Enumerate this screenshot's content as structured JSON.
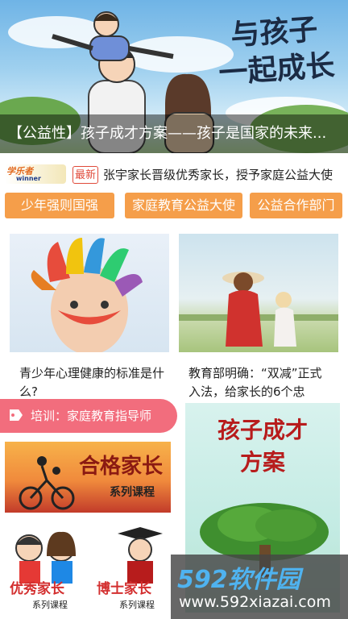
{
  "hero": {
    "title_line1": "与孩子",
    "title_line2": "一起成长",
    "caption": "【公益性】孩子成才方案——孩子是国家的未来..."
  },
  "news": {
    "logo_text": "学乐者",
    "logo_sub": "winner",
    "badge": "最新",
    "text": "张宇家长晋级优秀家长，授予家庭公益大使"
  },
  "buttons": [
    "少年强则国强",
    "家庭教育公益大使",
    "公益合作部门"
  ],
  "articles": [
    {
      "title": "青少年心理健康的标准是什么?"
    },
    {
      "title": "教育部明确：“双减”正式入法，给家长的6个忠"
    }
  ],
  "training": {
    "label": "培训：家庭教育指导师"
  },
  "courses": {
    "qualified_title": "合格家长",
    "qualified_sub": "系列课程",
    "excellent_title": "优秀家长",
    "excellent_sub": "系列课程",
    "doctor_title": "博士家长",
    "doctor_sub": "系列课程"
  },
  "promo": {
    "line1": "孩子成才",
    "line2": "方案"
  },
  "watermark": {
    "brand": "592软件园",
    "url": "www.592xiazai.com"
  },
  "colors": {
    "accent_orange": "#f59e4a",
    "ribbon_pink": "#f26d7d",
    "new_red": "#e04a3a"
  }
}
